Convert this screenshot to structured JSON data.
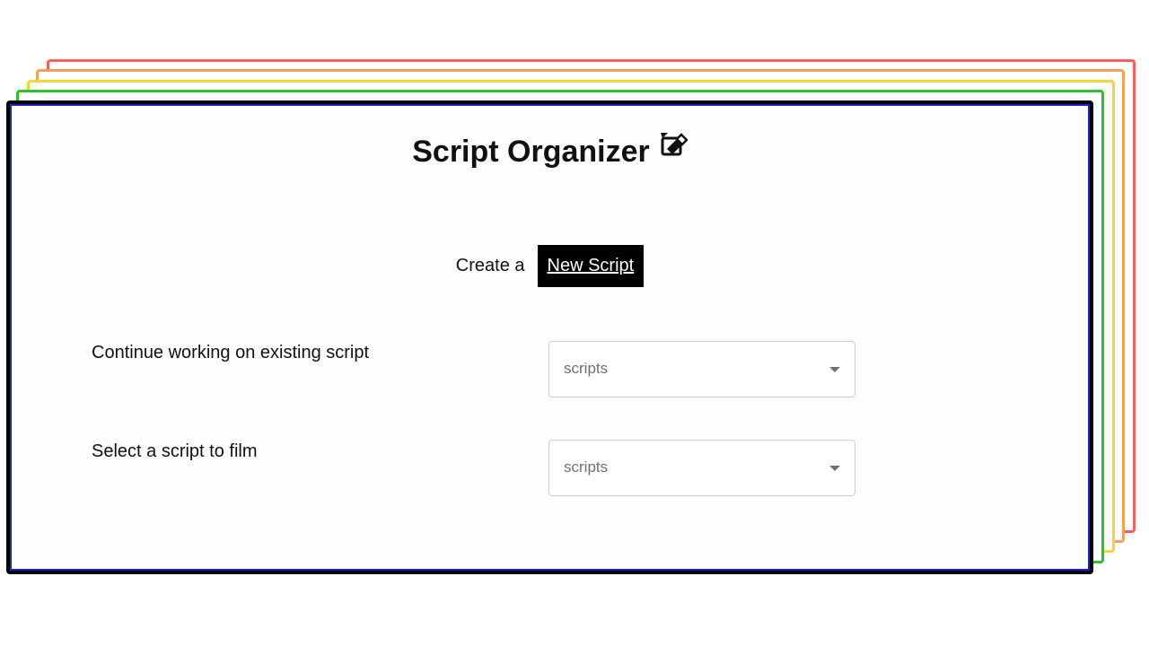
{
  "header": {
    "title": "Script Organizer",
    "title_icon": "edit-document-icon"
  },
  "create": {
    "prefix_text": "Create a",
    "button_label": "New Script"
  },
  "forms": {
    "continue": {
      "label": "Continue working on existing script",
      "placeholder": "scripts"
    },
    "film": {
      "label": "Select a script to film",
      "placeholder": "scripts"
    }
  },
  "colors": {
    "stack_card_1": "#f0625a",
    "stack_card_2": "#f4a05c",
    "stack_card_3": "#f6d43a",
    "stack_card_4": "#2fc02f",
    "main_card_border": "#000000",
    "main_card_inner_border": "#1a22c8",
    "button_background": "#000000",
    "button_text": "#ffffff"
  }
}
